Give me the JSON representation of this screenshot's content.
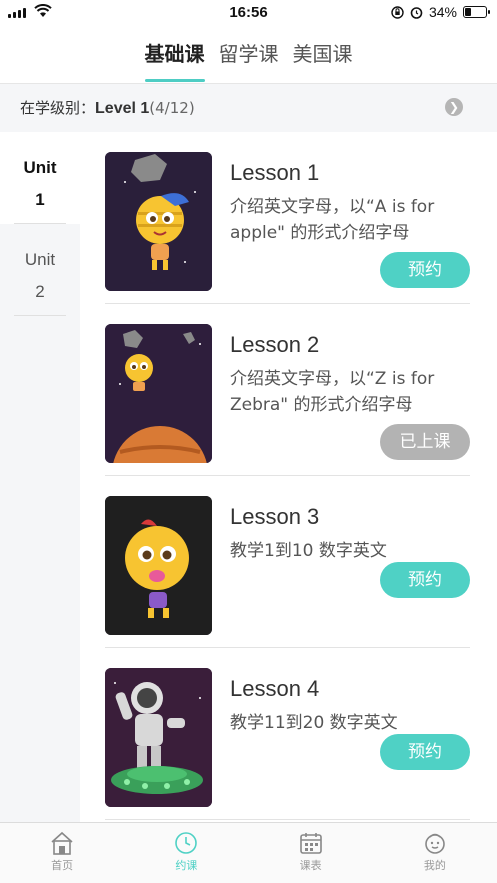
{
  "status": {
    "time": "16:56",
    "battery": "34%",
    "battery_level": 0.34
  },
  "tabs": [
    {
      "label": "基础课",
      "active": true
    },
    {
      "label": "留学课",
      "active": false
    },
    {
      "label": "美国课",
      "active": false
    }
  ],
  "level": {
    "prefix": "在学级别：",
    "name": "Level 1",
    "count": "(4/12)"
  },
  "sidebar": {
    "units": [
      {
        "label": "Unit",
        "num": "1",
        "active": true
      },
      {
        "label": "Unit",
        "num": "2",
        "active": false
      }
    ]
  },
  "lessons": [
    {
      "title": "Lesson 1",
      "desc": "介绍英文字母，以“A is for apple\" 的形式介绍字母",
      "button": "预约",
      "status": "book"
    },
    {
      "title": "Lesson 2",
      "desc": "介绍英文字母，以“Z is for Zebra\" 的形式介绍字母",
      "button": "已上课",
      "status": "done"
    },
    {
      "title": "Lesson 3",
      "desc": "教学1到10 数字英文",
      "button": "预约",
      "status": "book"
    },
    {
      "title": "Lesson 4",
      "desc": "教学11到20 数字英文",
      "button": "预约",
      "status": "book"
    }
  ],
  "bottom_nav": [
    {
      "label": "首页",
      "icon": "home-icon",
      "active": false
    },
    {
      "label": "约课",
      "icon": "clock-icon",
      "active": true
    },
    {
      "label": "课表",
      "icon": "calendar-icon",
      "active": false
    },
    {
      "label": "我的",
      "icon": "profile-face-icon",
      "active": false
    }
  ],
  "colors": {
    "accent": "#4fd1c5",
    "done_button": "#b3b3b3",
    "sidebar_bg": "#f5f6f8"
  }
}
